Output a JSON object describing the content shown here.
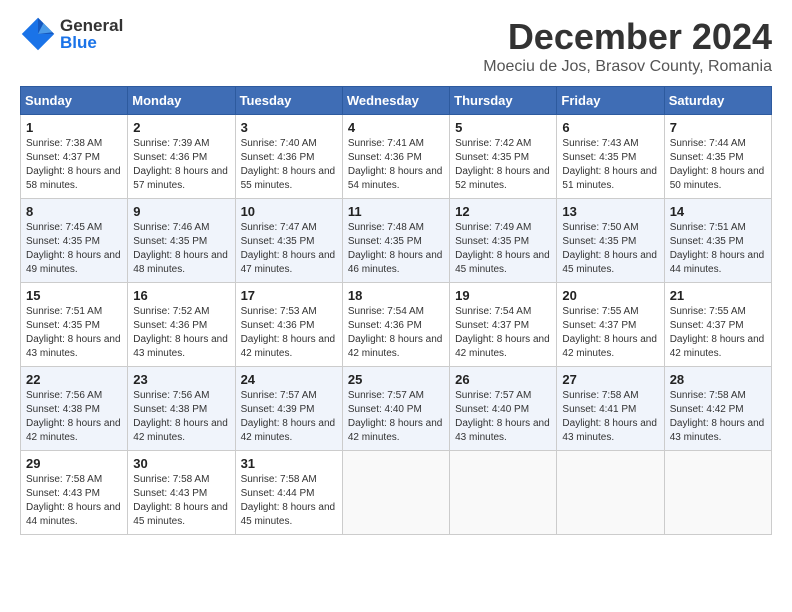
{
  "header": {
    "logo_general": "General",
    "logo_blue": "Blue",
    "month_title": "December 2024",
    "location": "Moeciu de Jos, Brasov County, Romania"
  },
  "calendar": {
    "days_of_week": [
      "Sunday",
      "Monday",
      "Tuesday",
      "Wednesday",
      "Thursday",
      "Friday",
      "Saturday"
    ],
    "weeks": [
      [
        {
          "day": "1",
          "sunrise": "Sunrise: 7:38 AM",
          "sunset": "Sunset: 4:37 PM",
          "daylight": "Daylight: 8 hours and 58 minutes."
        },
        {
          "day": "2",
          "sunrise": "Sunrise: 7:39 AM",
          "sunset": "Sunset: 4:36 PM",
          "daylight": "Daylight: 8 hours and 57 minutes."
        },
        {
          "day": "3",
          "sunrise": "Sunrise: 7:40 AM",
          "sunset": "Sunset: 4:36 PM",
          "daylight": "Daylight: 8 hours and 55 minutes."
        },
        {
          "day": "4",
          "sunrise": "Sunrise: 7:41 AM",
          "sunset": "Sunset: 4:36 PM",
          "daylight": "Daylight: 8 hours and 54 minutes."
        },
        {
          "day": "5",
          "sunrise": "Sunrise: 7:42 AM",
          "sunset": "Sunset: 4:35 PM",
          "daylight": "Daylight: 8 hours and 52 minutes."
        },
        {
          "day": "6",
          "sunrise": "Sunrise: 7:43 AM",
          "sunset": "Sunset: 4:35 PM",
          "daylight": "Daylight: 8 hours and 51 minutes."
        },
        {
          "day": "7",
          "sunrise": "Sunrise: 7:44 AM",
          "sunset": "Sunset: 4:35 PM",
          "daylight": "Daylight: 8 hours and 50 minutes."
        }
      ],
      [
        {
          "day": "8",
          "sunrise": "Sunrise: 7:45 AM",
          "sunset": "Sunset: 4:35 PM",
          "daylight": "Daylight: 8 hours and 49 minutes."
        },
        {
          "day": "9",
          "sunrise": "Sunrise: 7:46 AM",
          "sunset": "Sunset: 4:35 PM",
          "daylight": "Daylight: 8 hours and 48 minutes."
        },
        {
          "day": "10",
          "sunrise": "Sunrise: 7:47 AM",
          "sunset": "Sunset: 4:35 PM",
          "daylight": "Daylight: 8 hours and 47 minutes."
        },
        {
          "day": "11",
          "sunrise": "Sunrise: 7:48 AM",
          "sunset": "Sunset: 4:35 PM",
          "daylight": "Daylight: 8 hours and 46 minutes."
        },
        {
          "day": "12",
          "sunrise": "Sunrise: 7:49 AM",
          "sunset": "Sunset: 4:35 PM",
          "daylight": "Daylight: 8 hours and 45 minutes."
        },
        {
          "day": "13",
          "sunrise": "Sunrise: 7:50 AM",
          "sunset": "Sunset: 4:35 PM",
          "daylight": "Daylight: 8 hours and 45 minutes."
        },
        {
          "day": "14",
          "sunrise": "Sunrise: 7:51 AM",
          "sunset": "Sunset: 4:35 PM",
          "daylight": "Daylight: 8 hours and 44 minutes."
        }
      ],
      [
        {
          "day": "15",
          "sunrise": "Sunrise: 7:51 AM",
          "sunset": "Sunset: 4:35 PM",
          "daylight": "Daylight: 8 hours and 43 minutes."
        },
        {
          "day": "16",
          "sunrise": "Sunrise: 7:52 AM",
          "sunset": "Sunset: 4:36 PM",
          "daylight": "Daylight: 8 hours and 43 minutes."
        },
        {
          "day": "17",
          "sunrise": "Sunrise: 7:53 AM",
          "sunset": "Sunset: 4:36 PM",
          "daylight": "Daylight: 8 hours and 42 minutes."
        },
        {
          "day": "18",
          "sunrise": "Sunrise: 7:54 AM",
          "sunset": "Sunset: 4:36 PM",
          "daylight": "Daylight: 8 hours and 42 minutes."
        },
        {
          "day": "19",
          "sunrise": "Sunrise: 7:54 AM",
          "sunset": "Sunset: 4:37 PM",
          "daylight": "Daylight: 8 hours and 42 minutes."
        },
        {
          "day": "20",
          "sunrise": "Sunrise: 7:55 AM",
          "sunset": "Sunset: 4:37 PM",
          "daylight": "Daylight: 8 hours and 42 minutes."
        },
        {
          "day": "21",
          "sunrise": "Sunrise: 7:55 AM",
          "sunset": "Sunset: 4:37 PM",
          "daylight": "Daylight: 8 hours and 42 minutes."
        }
      ],
      [
        {
          "day": "22",
          "sunrise": "Sunrise: 7:56 AM",
          "sunset": "Sunset: 4:38 PM",
          "daylight": "Daylight: 8 hours and 42 minutes."
        },
        {
          "day": "23",
          "sunrise": "Sunrise: 7:56 AM",
          "sunset": "Sunset: 4:38 PM",
          "daylight": "Daylight: 8 hours and 42 minutes."
        },
        {
          "day": "24",
          "sunrise": "Sunrise: 7:57 AM",
          "sunset": "Sunset: 4:39 PM",
          "daylight": "Daylight: 8 hours and 42 minutes."
        },
        {
          "day": "25",
          "sunrise": "Sunrise: 7:57 AM",
          "sunset": "Sunset: 4:40 PM",
          "daylight": "Daylight: 8 hours and 42 minutes."
        },
        {
          "day": "26",
          "sunrise": "Sunrise: 7:57 AM",
          "sunset": "Sunset: 4:40 PM",
          "daylight": "Daylight: 8 hours and 43 minutes."
        },
        {
          "day": "27",
          "sunrise": "Sunrise: 7:58 AM",
          "sunset": "Sunset: 4:41 PM",
          "daylight": "Daylight: 8 hours and 43 minutes."
        },
        {
          "day": "28",
          "sunrise": "Sunrise: 7:58 AM",
          "sunset": "Sunset: 4:42 PM",
          "daylight": "Daylight: 8 hours and 43 minutes."
        }
      ],
      [
        {
          "day": "29",
          "sunrise": "Sunrise: 7:58 AM",
          "sunset": "Sunset: 4:43 PM",
          "daylight": "Daylight: 8 hours and 44 minutes."
        },
        {
          "day": "30",
          "sunrise": "Sunrise: 7:58 AM",
          "sunset": "Sunset: 4:43 PM",
          "daylight": "Daylight: 8 hours and 45 minutes."
        },
        {
          "day": "31",
          "sunrise": "Sunrise: 7:58 AM",
          "sunset": "Sunset: 4:44 PM",
          "daylight": "Daylight: 8 hours and 45 minutes."
        },
        null,
        null,
        null,
        null
      ]
    ]
  }
}
